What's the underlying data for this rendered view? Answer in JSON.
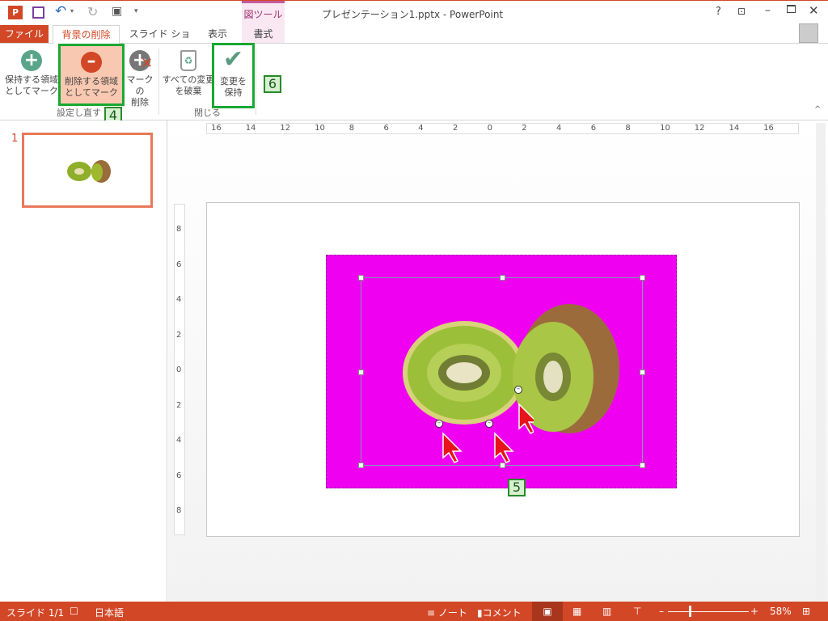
{
  "window": {
    "title": "プレゼンテーション1.pptx - PowerPoint",
    "help": "?"
  },
  "qat": {
    "icons": [
      "powerpoint-logo-icon",
      "save-icon",
      "undo-icon",
      "redo-icon",
      "present-icon",
      "customize-icon"
    ]
  },
  "context_tab": {
    "group": "図ツール",
    "tab": "書式"
  },
  "tabs": [
    {
      "label": "ファイル"
    },
    {
      "label": "背景の削除"
    },
    {
      "label": "スライド ショー"
    },
    {
      "label": "表示"
    }
  ],
  "ribbon": {
    "buttons": [
      {
        "label1": "保持する領域",
        "label2": "としてマーク"
      },
      {
        "label1": "削除する領域",
        "label2": "としてマーク"
      },
      {
        "label1": "マークの",
        "label2": "削除"
      },
      {
        "label1": "すべての変更",
        "label2": "を破棄"
      },
      {
        "label1": "変更を",
        "label2": "保持"
      }
    ],
    "groups": [
      "設定し直す",
      "閉じる"
    ]
  },
  "callouts": [
    "4",
    "5",
    "6"
  ],
  "thumbnail": {
    "number": "1"
  },
  "ruler": {
    "h": [
      "16",
      "14",
      "12",
      "10",
      "8",
      "6",
      "4",
      "2",
      "0",
      "2",
      "4",
      "6",
      "8",
      "10",
      "12",
      "14",
      "16"
    ],
    "v": [
      "8",
      "6",
      "4",
      "2",
      "0",
      "2",
      "4",
      "6",
      "8"
    ]
  },
  "status": {
    "slide": "スライド 1/1",
    "language": "日本語",
    "notes": "ノート",
    "comments": "コメント",
    "zoom": "58%",
    "zoom_level": 58
  },
  "colors": {
    "accent": "#d24726",
    "background_removal": "#ff00ff",
    "callout_border": "#19a832"
  }
}
